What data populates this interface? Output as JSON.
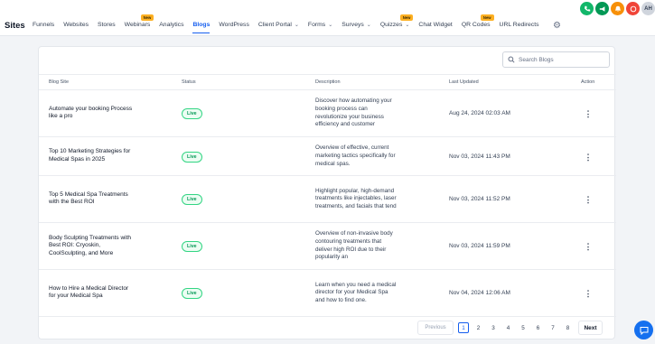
{
  "app": {
    "title": "Sites"
  },
  "nav": {
    "items": [
      {
        "label": "Funnels"
      },
      {
        "label": "Websites"
      },
      {
        "label": "Stores"
      },
      {
        "label": "Webinars",
        "badge": "New"
      },
      {
        "label": "Analytics"
      },
      {
        "label": "Blogs",
        "active": true
      },
      {
        "label": "WordPress"
      },
      {
        "label": "Client Portal",
        "dropdown": true
      },
      {
        "label": "Forms",
        "dropdown": true
      },
      {
        "label": "Surveys",
        "dropdown": true
      },
      {
        "label": "Quizzes",
        "dropdown": true,
        "badge": "New"
      },
      {
        "label": "Chat Widget"
      },
      {
        "label": "QR Codes",
        "badge": "New"
      },
      {
        "label": "URL Redirects"
      }
    ],
    "avatar_initials": "AH"
  },
  "search": {
    "placeholder": "Search Blogs"
  },
  "table": {
    "headers": {
      "blog_site": "Blog Site",
      "status": "Status",
      "description": "Description",
      "last_updated": "Last Updated",
      "action": "Action"
    },
    "rows": [
      {
        "title": "Automate your booking Process like a pro",
        "status": "Live",
        "description": "Discover how automating your booking process can revolutionize your business efficiency and customer",
        "last_updated": "Aug 24, 2024 02:03 AM"
      },
      {
        "title": "Top 10 Marketing Strategies for Medical Spas in 2025",
        "status": "Live",
        "description": "Overview of effective, current marketing tactics specifically for medical spas.",
        "last_updated": "Nov 03, 2024 11:43 PM"
      },
      {
        "title": "Top 5 Medical Spa Treatments with the Best ROI",
        "status": "Live",
        "description": "Highlight popular, high-demand treatments like injectables, laser treatments, and facials that tend",
        "last_updated": "Nov 03, 2024 11:52 PM"
      },
      {
        "title": "Body Sculpting Treatments with Best ROI: Cryoskin, CoolSculpting, and More",
        "status": "Live",
        "description": "Overview of non-invasive body contouring treatments that deliver high ROI due to their popularity an",
        "last_updated": "Nov 03, 2024 11:59 PM"
      },
      {
        "title": "How to Hire a Medical Director for your Medical Spa",
        "status": "Live",
        "description": "Learn when you need a medical director for your Medical Spa and how to find one.",
        "last_updated": "Nov 04, 2024 12:06 AM"
      }
    ]
  },
  "pagination": {
    "previous": "Previous",
    "pages": [
      "1",
      "2",
      "3",
      "4",
      "5",
      "6",
      "7",
      "8"
    ],
    "current": "1",
    "next": "Next"
  }
}
